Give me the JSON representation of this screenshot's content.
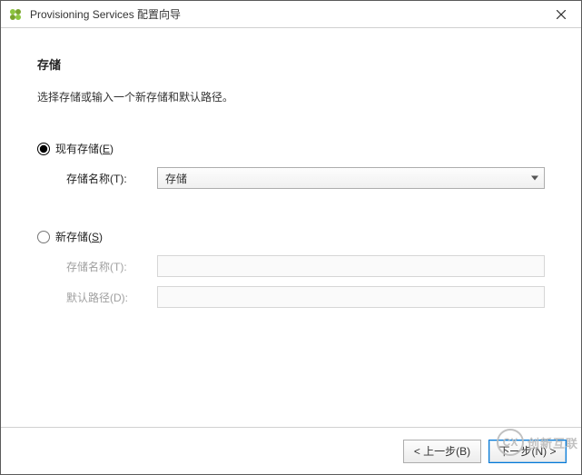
{
  "window": {
    "title": "Provisioning Services 配置向导"
  },
  "page": {
    "heading": "存储",
    "subtitle": "选择存储或输入一个新存储和默认路径。"
  },
  "existing": {
    "radio_label": "现有存储(E)",
    "radio_hotkey": "E",
    "name_label": "存储名称(T):",
    "selected_value": "存储"
  },
  "newstore": {
    "radio_label": "新存储(S)",
    "radio_hotkey": "S",
    "name_label": "存储名称(T):",
    "name_value": "",
    "path_label": "默认路径(D):",
    "path_value": ""
  },
  "footer": {
    "back": "< 上一步(B)",
    "next": "下一步(N) >"
  },
  "selection": {
    "existing_checked": true,
    "new_checked": false
  },
  "watermark": {
    "text": "创新互联"
  }
}
